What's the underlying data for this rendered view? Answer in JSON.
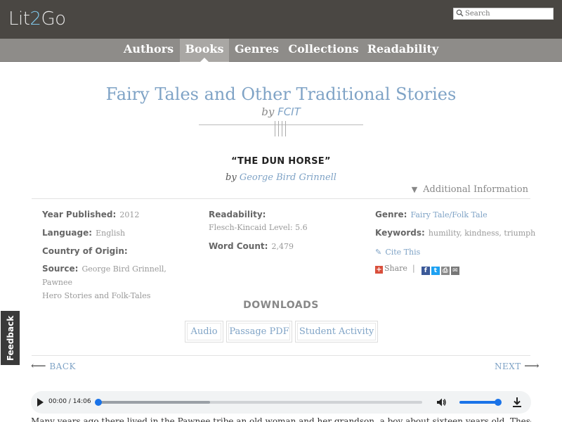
{
  "header": {
    "logo_prefix": "Lit",
    "logo_two": "2",
    "logo_suffix": "Go",
    "search_placeholder": "Search"
  },
  "nav": {
    "items": [
      {
        "label": "Authors"
      },
      {
        "label": "Books",
        "active": true
      },
      {
        "label": "Genres"
      },
      {
        "label": "Collections"
      },
      {
        "label": "Readability"
      }
    ]
  },
  "collection": {
    "title": "Fairy Tales and Other Traditional Stories",
    "by": "by",
    "author": "FCIT"
  },
  "story": {
    "title": "“THE DUN HORSE”",
    "by": "by",
    "author": "George Bird Grinnell"
  },
  "additional_info": {
    "label": "Additional Information"
  },
  "info": {
    "year_label": "Year Published:",
    "year_value": "2012",
    "language_label": "Language:",
    "language_value": "English",
    "country_label": "Country of Origin:",
    "country_value": "",
    "source_label": "Source:",
    "source_value_1": "George Bird Grinnell, Pawnee",
    "source_value_2": "Hero Stories and Folk-Tales",
    "readability_label": "Readability:",
    "readability_value": "Flesch-Kincaid Level: 5.6",
    "wordcount_label": "Word Count:",
    "wordcount_value": "2,479",
    "genre_label": "Genre:",
    "genre_value": "Fairy Tale/Folk Tale",
    "keywords_label": "Keywords:",
    "keywords_value": "humility, kindness, triumph",
    "cite_label": "Cite This",
    "share_label": "Share",
    "share_separator": "|"
  },
  "downloads": {
    "title": "DOWNLOADS",
    "buttons": [
      {
        "label": "Audio"
      },
      {
        "label": "Passage PDF"
      },
      {
        "label": "Student Activity"
      }
    ]
  },
  "feedback": {
    "label": "Feedback"
  },
  "pager": {
    "back_label": "BACK",
    "next_label": "NEXT"
  },
  "player": {
    "time": "00:00 / 14:06",
    "progress": 0.0
  },
  "body_text": "Many years ago there lived in the Pawnee tribe an old woman and her grandson, a boy about sixteen years old. These"
}
